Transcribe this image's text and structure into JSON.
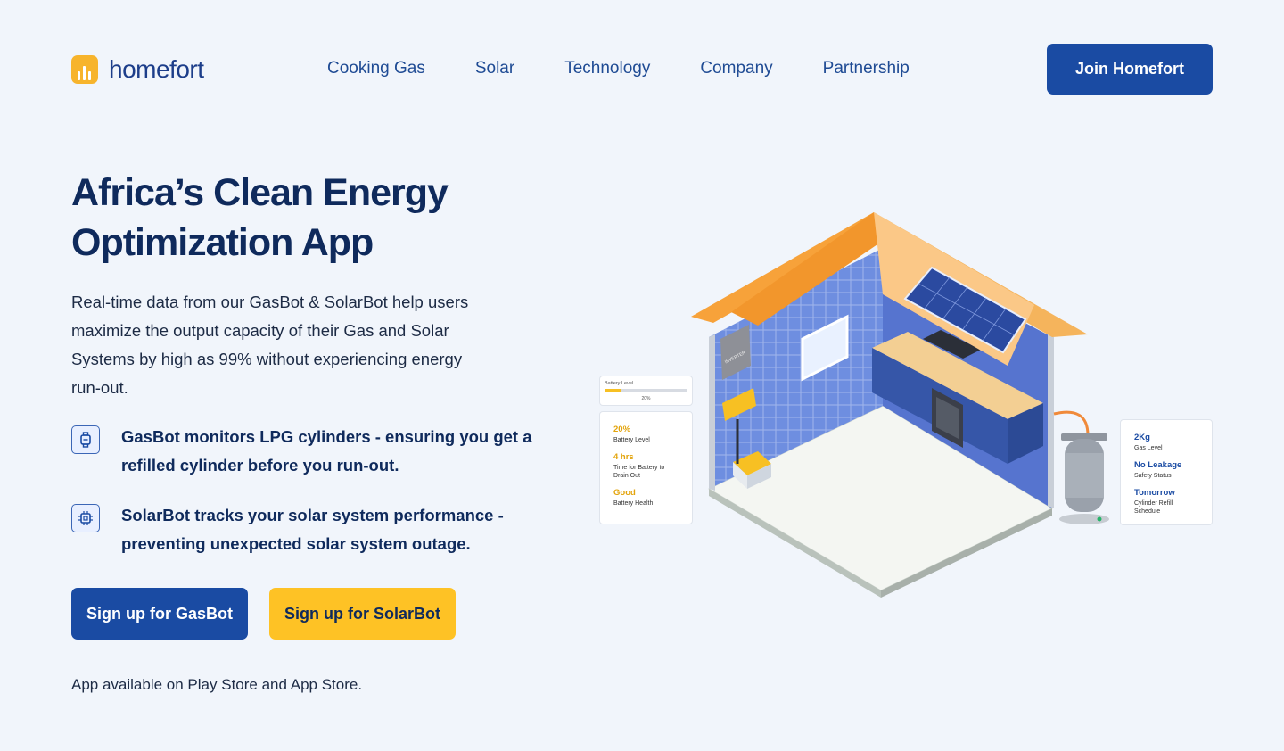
{
  "brand": {
    "name": "homefort",
    "logo_color": "#f7b42c"
  },
  "nav": {
    "links": [
      "Cooking Gas",
      "Solar",
      "Technology",
      "Company",
      "Partnership"
    ],
    "cta": "Join Homefort"
  },
  "hero": {
    "title": "Africa’s Clean Energy Optimization App",
    "description": "Real-time data from our GasBot & SolarBot help users maximize the output capacity of their Gas and Solar Systems by high as 99% without experiencing energy run-out.",
    "features": [
      {
        "icon": "gas-sensor-icon",
        "text": "GasBot monitors LPG cylinders - ensuring you get a refilled cylinder before you run-out."
      },
      {
        "icon": "chip-icon",
        "text": "SolarBot tracks your solar system performance - preventing unexpected solar system outage."
      }
    ],
    "buttons": {
      "gasbot": "Sign up for GasBot",
      "solarbot": "Sign up for SolarBot"
    },
    "app_note": "App available on Play Store and App Store."
  },
  "illustration": {
    "battery_bar": {
      "label": "Battery Level",
      "value": "20%",
      "fraction": 0.2
    },
    "solar_card": [
      {
        "value": "20%",
        "label": "Battery Level"
      },
      {
        "value": "4 hrs",
        "label": "Time for Battery to Drain Out"
      },
      {
        "value": "Good",
        "label": "Battery Health"
      }
    ],
    "gas_card": [
      {
        "value": "2Kg",
        "label": "Gas Level"
      },
      {
        "value": "No Leakage",
        "label": "Safety Status"
      },
      {
        "value": "Tomorrow",
        "label": "Cylinder Refill Schedule"
      }
    ],
    "inverter_label": "INVERTER"
  },
  "colors": {
    "primary": "#1a4ba3",
    "accent": "#fec225",
    "heading": "#0f2a5c",
    "roof": "#f7a23a",
    "wall": "#5b7ad6",
    "stat_yellow": "#e3a40c",
    "stat_blue": "#1a4ba3"
  }
}
